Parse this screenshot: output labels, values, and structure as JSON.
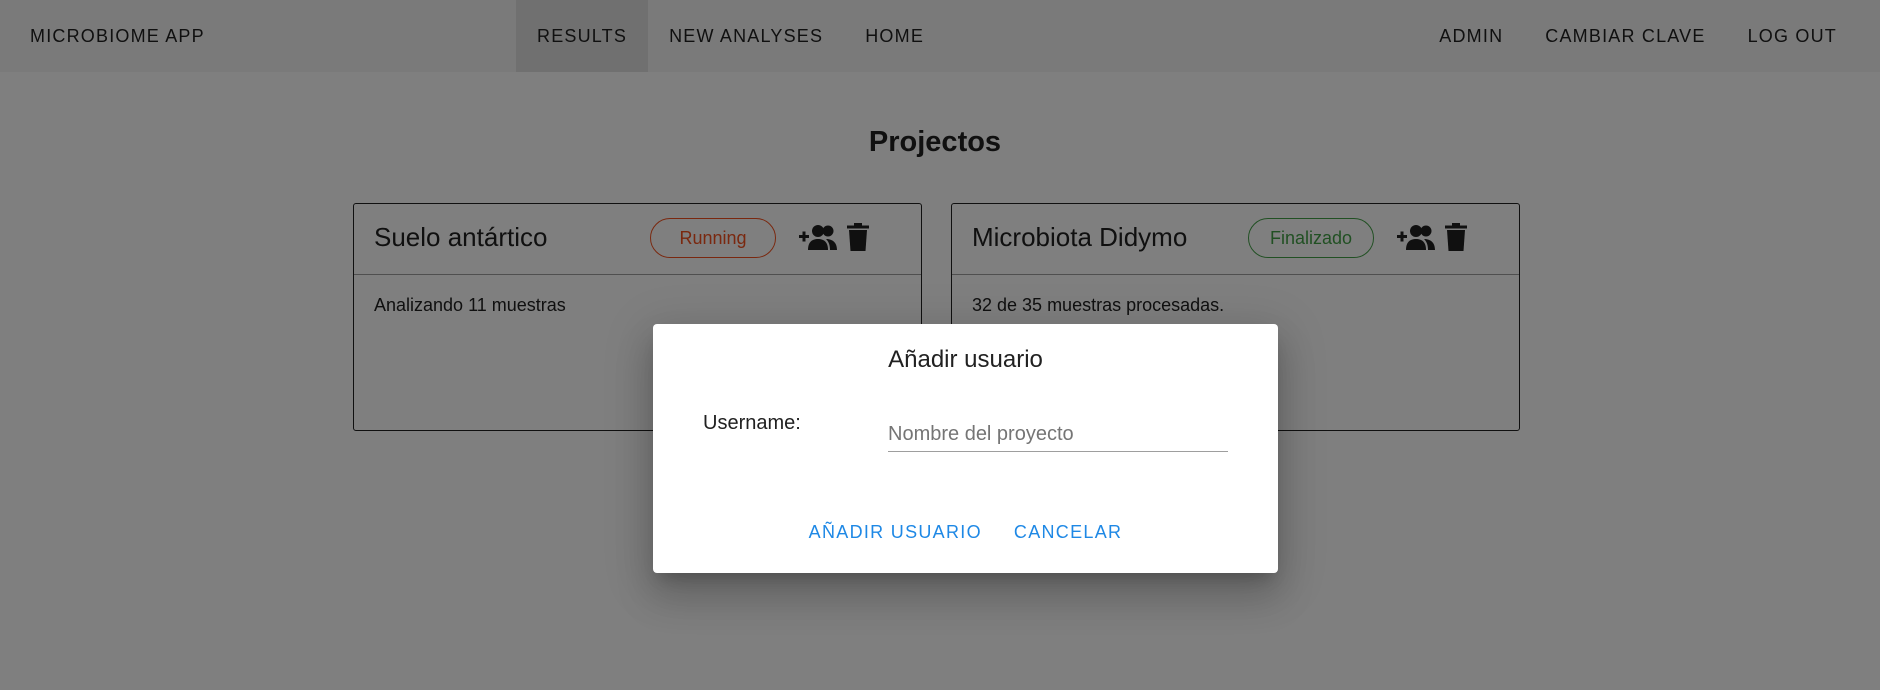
{
  "navbar": {
    "brand": "MICROBIOME APP",
    "center_items": [
      {
        "label": "RESULTS",
        "active": true
      },
      {
        "label": "NEW ANALYSES",
        "active": false
      },
      {
        "label": "HOME",
        "active": false
      }
    ],
    "right_items": [
      {
        "label": "ADMIN"
      },
      {
        "label": "CAMBIAR CLAVE"
      },
      {
        "label": "LOG OUT"
      }
    ]
  },
  "main": {
    "title": "Projectos",
    "projects": [
      {
        "name": "Suelo antártico",
        "status": "Running",
        "status_color": "#f4511e",
        "description": "Analizando 11 muestras",
        "icons": [
          "add-user-icon",
          "trash-icon"
        ]
      },
      {
        "name": "Microbiota Didymo",
        "status": "Finalizado",
        "status_color": "#43a047",
        "description": "32 de 35 muestras procesadas.",
        "icons": [
          "add-user-icon",
          "trash-icon"
        ]
      }
    ]
  },
  "dialog": {
    "title": "Añadir usuario",
    "username_label": "Username:",
    "username_value": "",
    "username_placeholder": "Nombre del proyecto",
    "confirm_label": "AÑADIR USUARIO",
    "cancel_label": "CANCELAR",
    "accent_color": "#1e88e5"
  }
}
